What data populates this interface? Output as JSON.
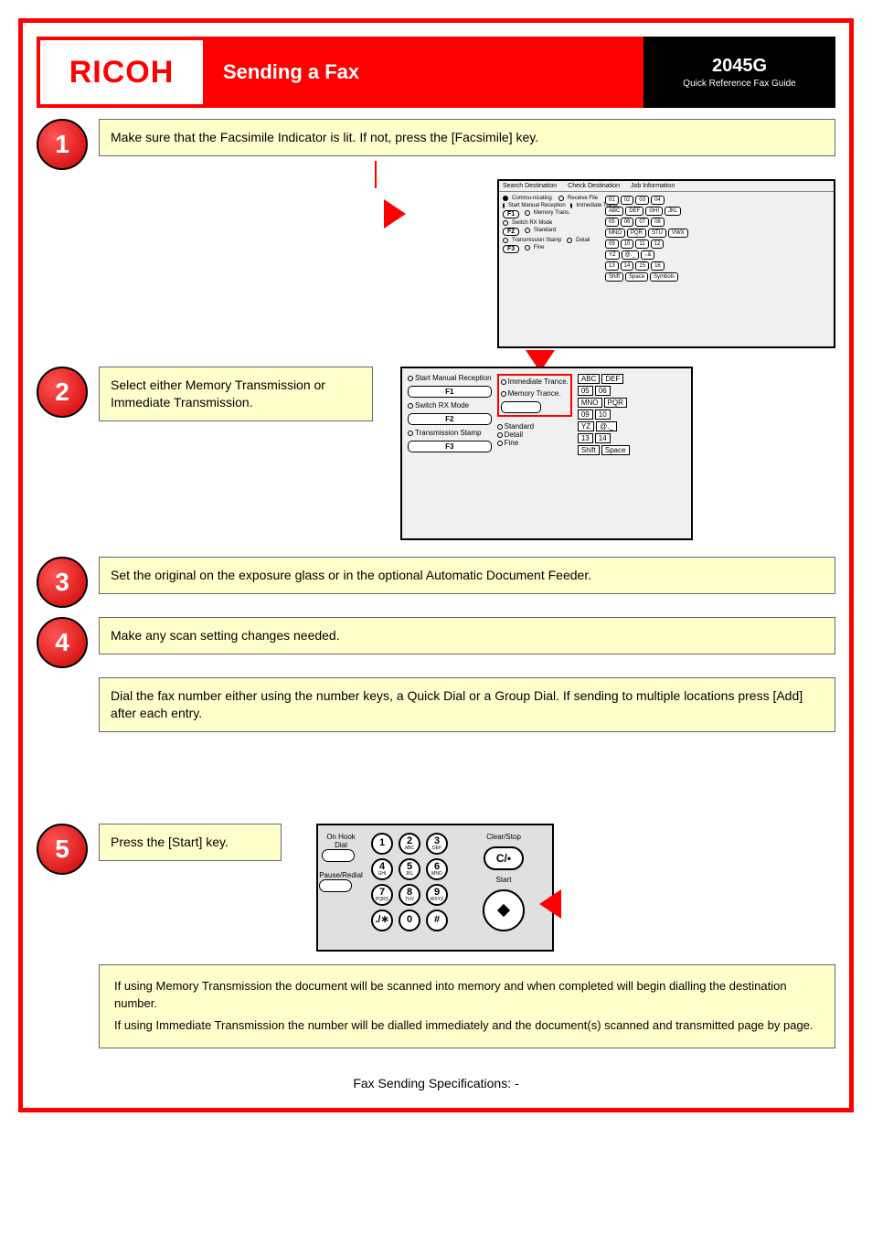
{
  "brand": "RICOH",
  "title": "Sending a Fax",
  "model": "2045G",
  "subtitle": "Quick Reference Fax Guide",
  "steps": {
    "s1": {
      "num": "1",
      "text": "Make sure that the Facsimile Indicator is lit. If not, press the [Facsimile] key."
    },
    "s2": {
      "num": "2",
      "text": "Select either Memory Transmission or Immediate Transmission."
    },
    "s3": {
      "num": "3",
      "text": "Set the original on the exposure glass or in the optional Automatic Document Feeder."
    },
    "s4": {
      "num": "4",
      "text": "Make any scan setting changes needed."
    },
    "s4a": "Dial the fax number either using the number keys, a Quick Dial or a Group Dial. If sending to multiple locations press [Add] after each entry.",
    "s5": {
      "num": "5",
      "text": "Press the [Start] key."
    }
  },
  "note": {
    "line1": "If using Memory Transmission the document will be scanned into memory and when completed will begin dialling the destination number.",
    "line2": "If using Immediate Transmission the number will be dialled immediately and the document(s) scanned and transmitted page by page."
  },
  "spec_label": "Fax Sending Specifications: -",
  "panel": {
    "head": {
      "search": "Search Destination",
      "check": "Check Destination",
      "job": "Job Information"
    },
    "commu": "Commu-nicating",
    "receive": "Receive File",
    "start_manual": "Start Manual Reception",
    "immediate": "Immediate Trans.",
    "memory": "Memory Trans.",
    "immediate2": "Immediate Trance.",
    "memory2": "Memory Trance.",
    "switch_rx": "Switch RX Mode",
    "standard": "Standard",
    "detail": "Detail",
    "fine": "Fine",
    "trans_stamp": "Transmission Stamp",
    "f1": "F1",
    "f2": "F2",
    "f3": "F3",
    "abc": "ABC",
    "def": "DEF",
    "ghi": "GHI",
    "jkl": "JKL",
    "mno": "MNO",
    "pqr": "PQR",
    "stu": "STU",
    "vwx": "VWX",
    "yz": "YZ",
    "at": "@._",
    "dash": "-.&",
    "shift": "Shift",
    "space": "Space",
    "symbols": "Symbols"
  },
  "keypad": {
    "onhook": "On Hook Dial",
    "pause": "Pause/Redial",
    "clear": "Clear/Stop",
    "clearkey": "C/•",
    "start": "Start",
    "k1": "1",
    "k2": "2",
    "k3": "3",
    "k4": "4",
    "k5": "5",
    "k6": "6",
    "k7": "7",
    "k8": "8",
    "k9": "9",
    "k0": "0",
    "kstar": "./∗",
    "khash": "#",
    "s2": "ABC",
    "s3": "DEF",
    "s4": "GHI",
    "s5": "JKL",
    "s6": "MNO",
    "s7": "PQRS",
    "s8": "TUV",
    "s9": "WXYZ"
  }
}
